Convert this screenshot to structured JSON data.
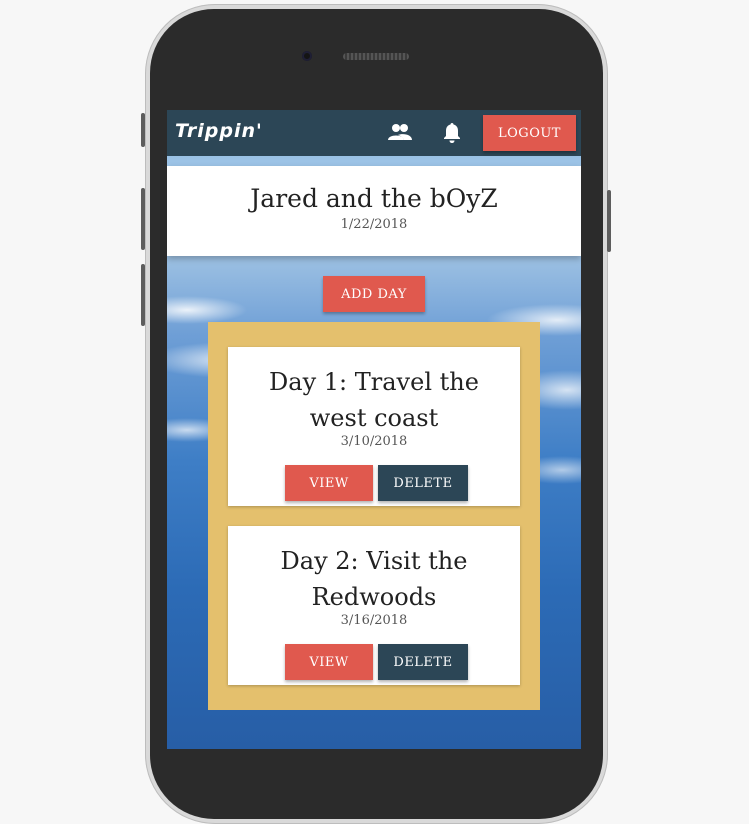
{
  "navbar": {
    "brand": "Trippin'",
    "friends_icon": "group-icon",
    "notifications_icon": "bell-icon",
    "logout_label": "LOGOUT"
  },
  "trip": {
    "title": "Jared and the bOyZ",
    "date": "1/22/2018"
  },
  "add_day_label": "ADD DAY",
  "days": [
    {
      "title": "Day 1: Travel the west coast",
      "date": "3/10/2018",
      "view_label": "VIEW",
      "delete_label": "DELETE"
    },
    {
      "title": "Day 2: Visit the Redwoods",
      "date": "3/16/2018",
      "view_label": "VIEW",
      "delete_label": "DELETE"
    }
  ],
  "colors": {
    "navbar": "#2c4656",
    "accent": "#e0594e",
    "panel": "#e4c06d"
  }
}
